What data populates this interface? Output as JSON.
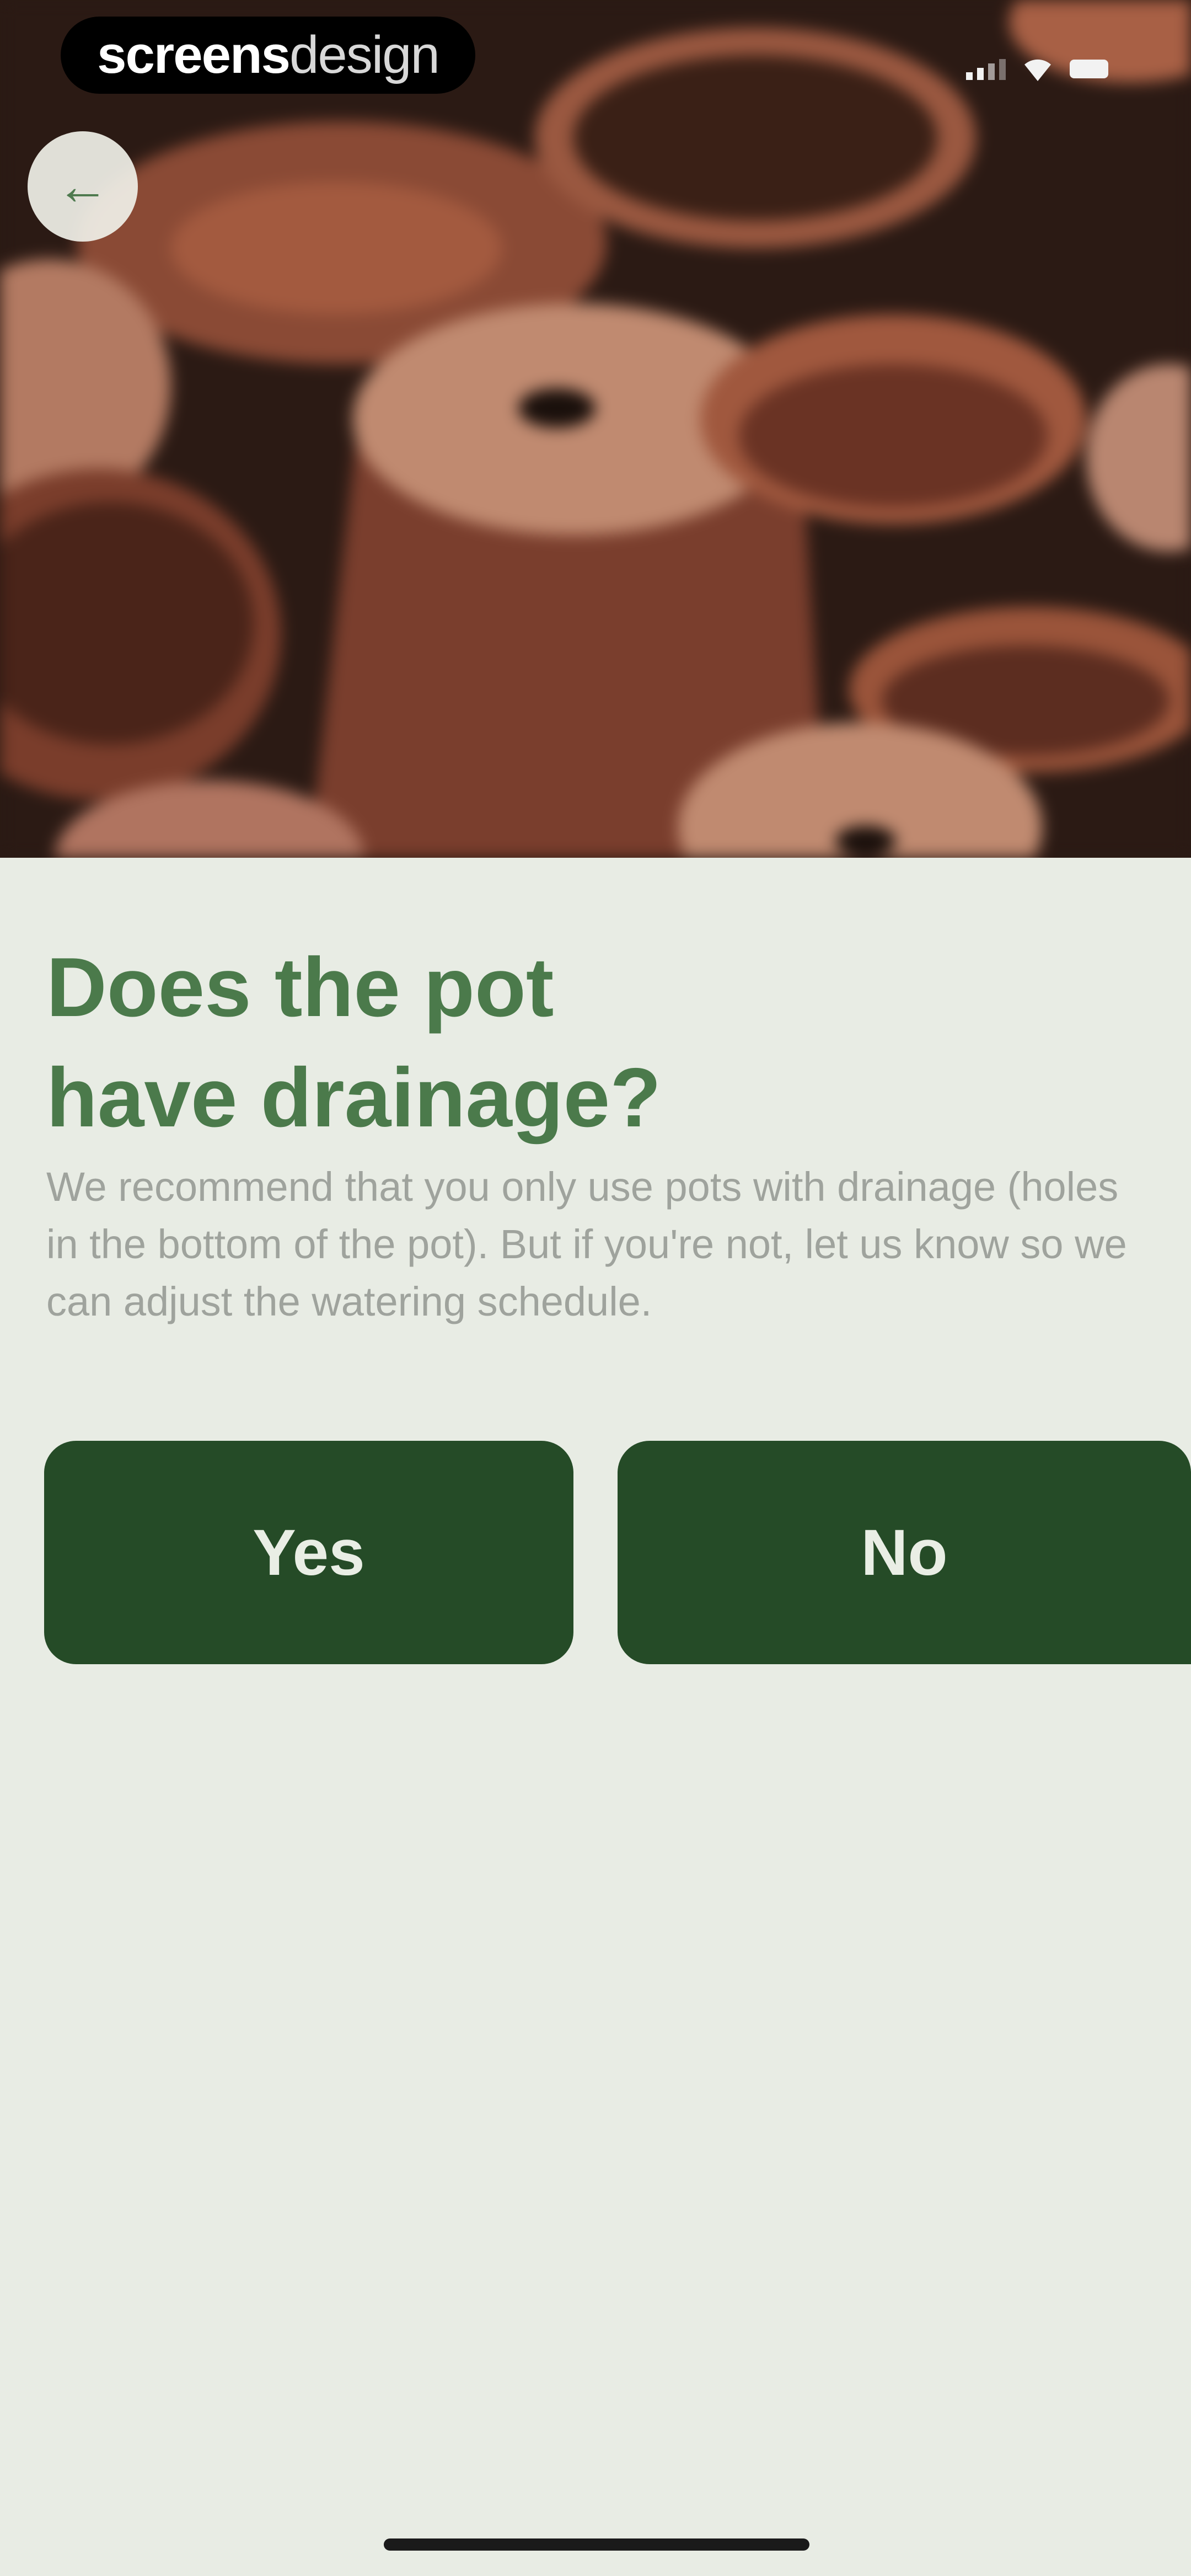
{
  "watermark": {
    "bold": "screens",
    "light": "design"
  },
  "nav": {
    "back_icon": "←"
  },
  "question": {
    "title_line1": "Does the pot",
    "title_line2": "have drainage?",
    "description": "We recommend that you only use pots with drainage (holes in the bottom of the pot). But if you're not, let us know so we can adjust the watering schedule."
  },
  "buttons": {
    "yes": "Yes",
    "no": "No"
  },
  "colors": {
    "accent": "#254b27",
    "title": "#4b7a4b",
    "background": "#e8ece4"
  }
}
